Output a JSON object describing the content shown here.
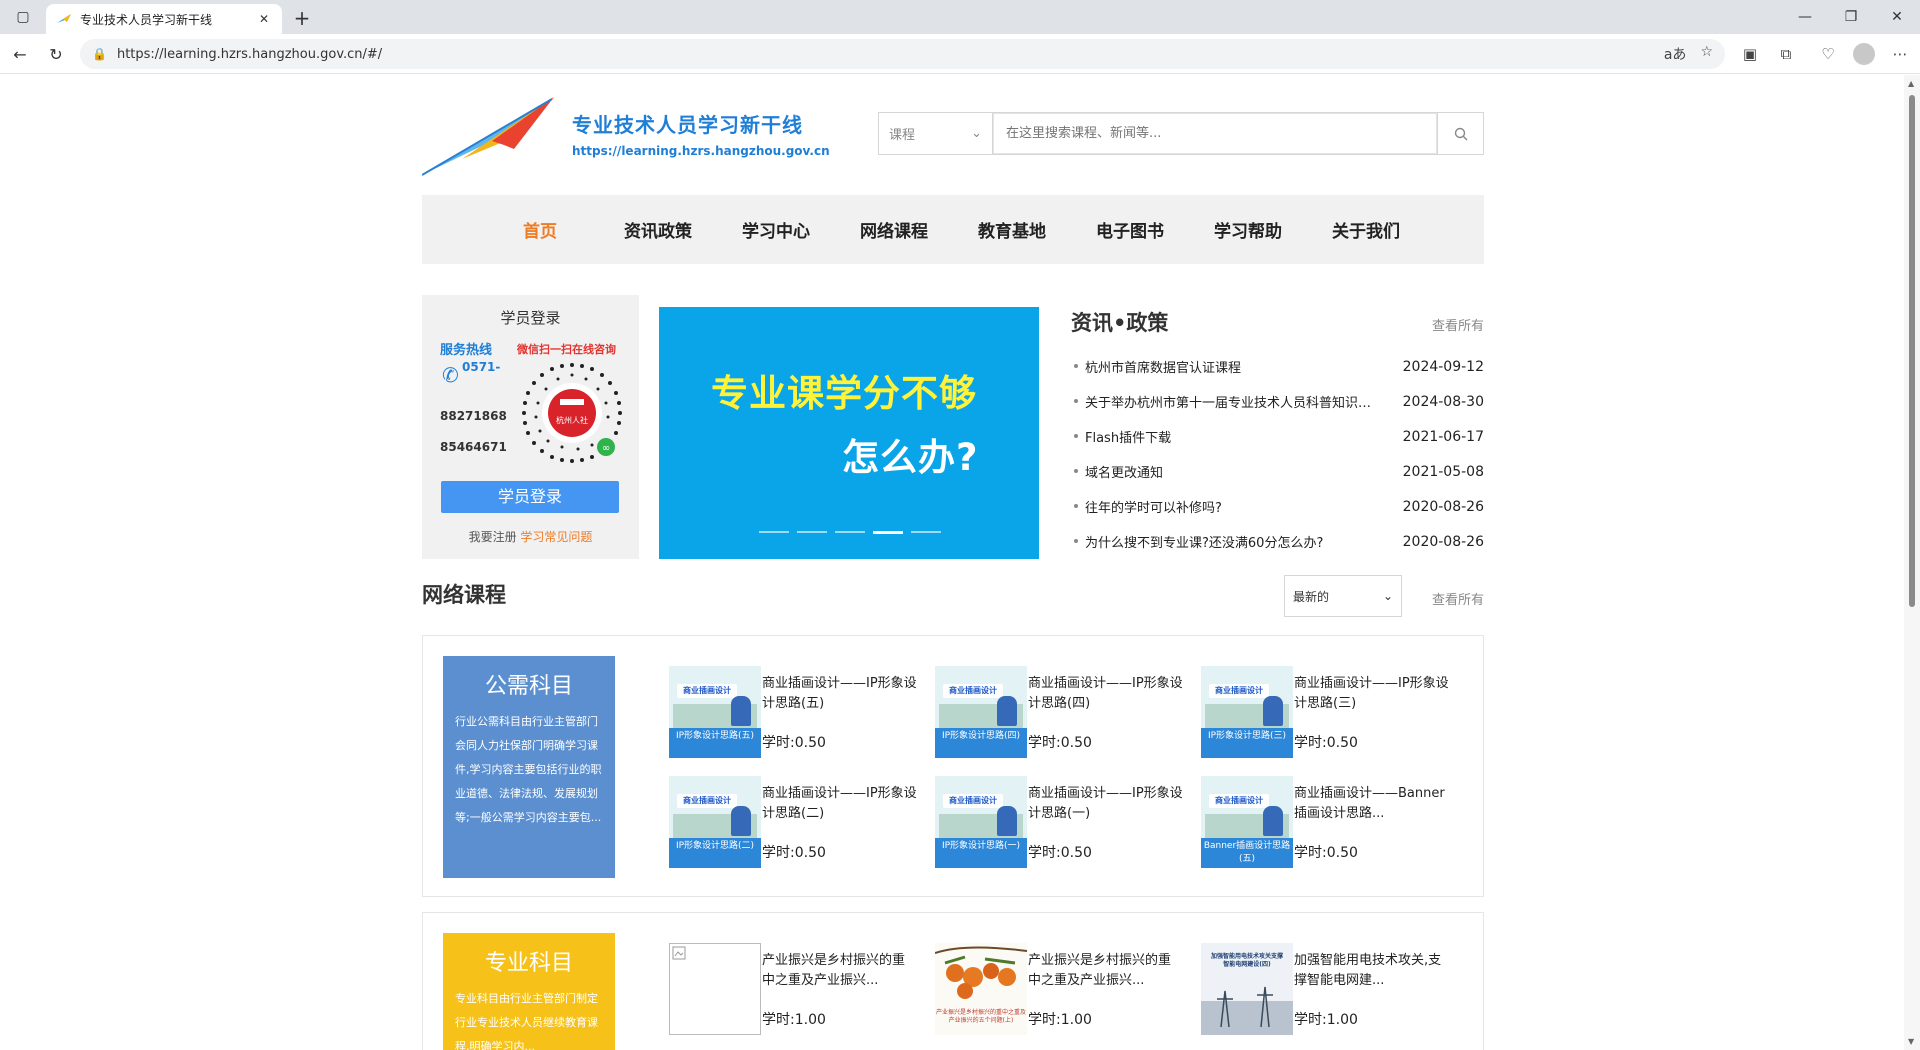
{
  "browser": {
    "tab_title": "专业技术人员学习新干线",
    "url": "https://learning.hzrs.hangzhou.gov.cn/#/"
  },
  "header": {
    "site_name": "专业技术人员学习新干线",
    "site_url": "https://learning.hzrs.hangzhou.gov.cn",
    "search_category": "课程",
    "search_placeholder": "在这里搜索课程、新闻等..."
  },
  "nav": {
    "items": [
      "首页",
      "资讯政策",
      "学习中心",
      "网络课程",
      "教育基地",
      "电子图书",
      "学习帮助",
      "关于我们"
    ],
    "active_index": 0
  },
  "login": {
    "title": "学员登录",
    "hotline_label": "服务热线",
    "hotline_prefix": "0571-",
    "numbers": [
      "88271868",
      "85464671"
    ],
    "wechat_text": "微信扫一扫在线咨询",
    "qr_label": "杭州人社",
    "button": "学员登录",
    "register": "我要注册",
    "faq": "学习常见问题"
  },
  "banner": {
    "line1": "专业课学分不够",
    "line2": "怎么办?"
  },
  "news": {
    "title": "资讯•政策",
    "more": "查看所有",
    "items": [
      {
        "title": "杭州市首席数据官认证课程",
        "date": "2024-09-12"
      },
      {
        "title": "关于举办杭州市第十一届专业技术人员科普知识竞赛的通知",
        "date": "2024-08-30"
      },
      {
        "title": "Flash插件下载",
        "date": "2021-06-17"
      },
      {
        "title": "域名更改通知",
        "date": "2021-05-08"
      },
      {
        "title": "往年的学时可以补修吗?",
        "date": "2020-08-26"
      },
      {
        "title": "为什么搜不到专业课?还没满60分怎么办?",
        "date": "2020-08-26"
      }
    ]
  },
  "courses": {
    "title": "网络课程",
    "sort": "最新的",
    "more": "查看所有",
    "public": {
      "name": "公需科目",
      "desc": "行业公需科目由行业主管部门会同人力社保部门明确学习课件,学习内容主要包括行业的职业道德、法律法规、发展规划等;一般公需学习内容主要包...",
      "color": "#5b8fd0",
      "items": [
        {
          "title": "商业插画设计——IP形象设计思路(五)",
          "hours": "学时:0.50",
          "thumb_title": "商业插画设计",
          "thumb_caption": "IP形象设计思路(五)"
        },
        {
          "title": "商业插画设计——IP形象设计思路(四)",
          "hours": "学时:0.50",
          "thumb_title": "商业插画设计",
          "thumb_caption": "IP形象设计思路(四)"
        },
        {
          "title": "商业插画设计——IP形象设计思路(三)",
          "hours": "学时:0.50",
          "thumb_title": "商业插画设计",
          "thumb_caption": "IP形象设计思路(三)"
        },
        {
          "title": "商业插画设计——IP形象设计思路(二)",
          "hours": "学时:0.50",
          "thumb_title": "商业插画设计",
          "thumb_caption": "IP形象设计思路(二)"
        },
        {
          "title": "商业插画设计——IP形象设计思路(一)",
          "hours": "学时:0.50",
          "thumb_title": "商业插画设计",
          "thumb_caption": "IP形象设计思路(一)"
        },
        {
          "title": "商业插画设计——Banner插画设计思路...",
          "hours": "学时:0.50",
          "thumb_title": "商业插画设计",
          "thumb_caption": "Banner插画设计思路(五)"
        }
      ]
    },
    "professional": {
      "name": "专业科目",
      "desc": "专业科目由行业主管部门制定行业专业技术人员继续教育课程,明确学习内...",
      "color": "#f6c21a",
      "items": [
        {
          "title": "产业振兴是乡村振兴的重中之重及产业振兴...",
          "hours": "学时:1.00"
        },
        {
          "title": "产业振兴是乡村振兴的重中之重及产业振兴...",
          "hours": "学时:1.00",
          "thumb_caption": "产业振兴是乡村振兴的重中之重及产业振兴的五个问题(上)"
        },
        {
          "title": "加强智能用电技术攻关,支撑智能电网建...",
          "hours": "学时:1.00",
          "thumb_caption": "加强智能用电技术攻关支撑智能电网建设(四)"
        }
      ]
    }
  }
}
